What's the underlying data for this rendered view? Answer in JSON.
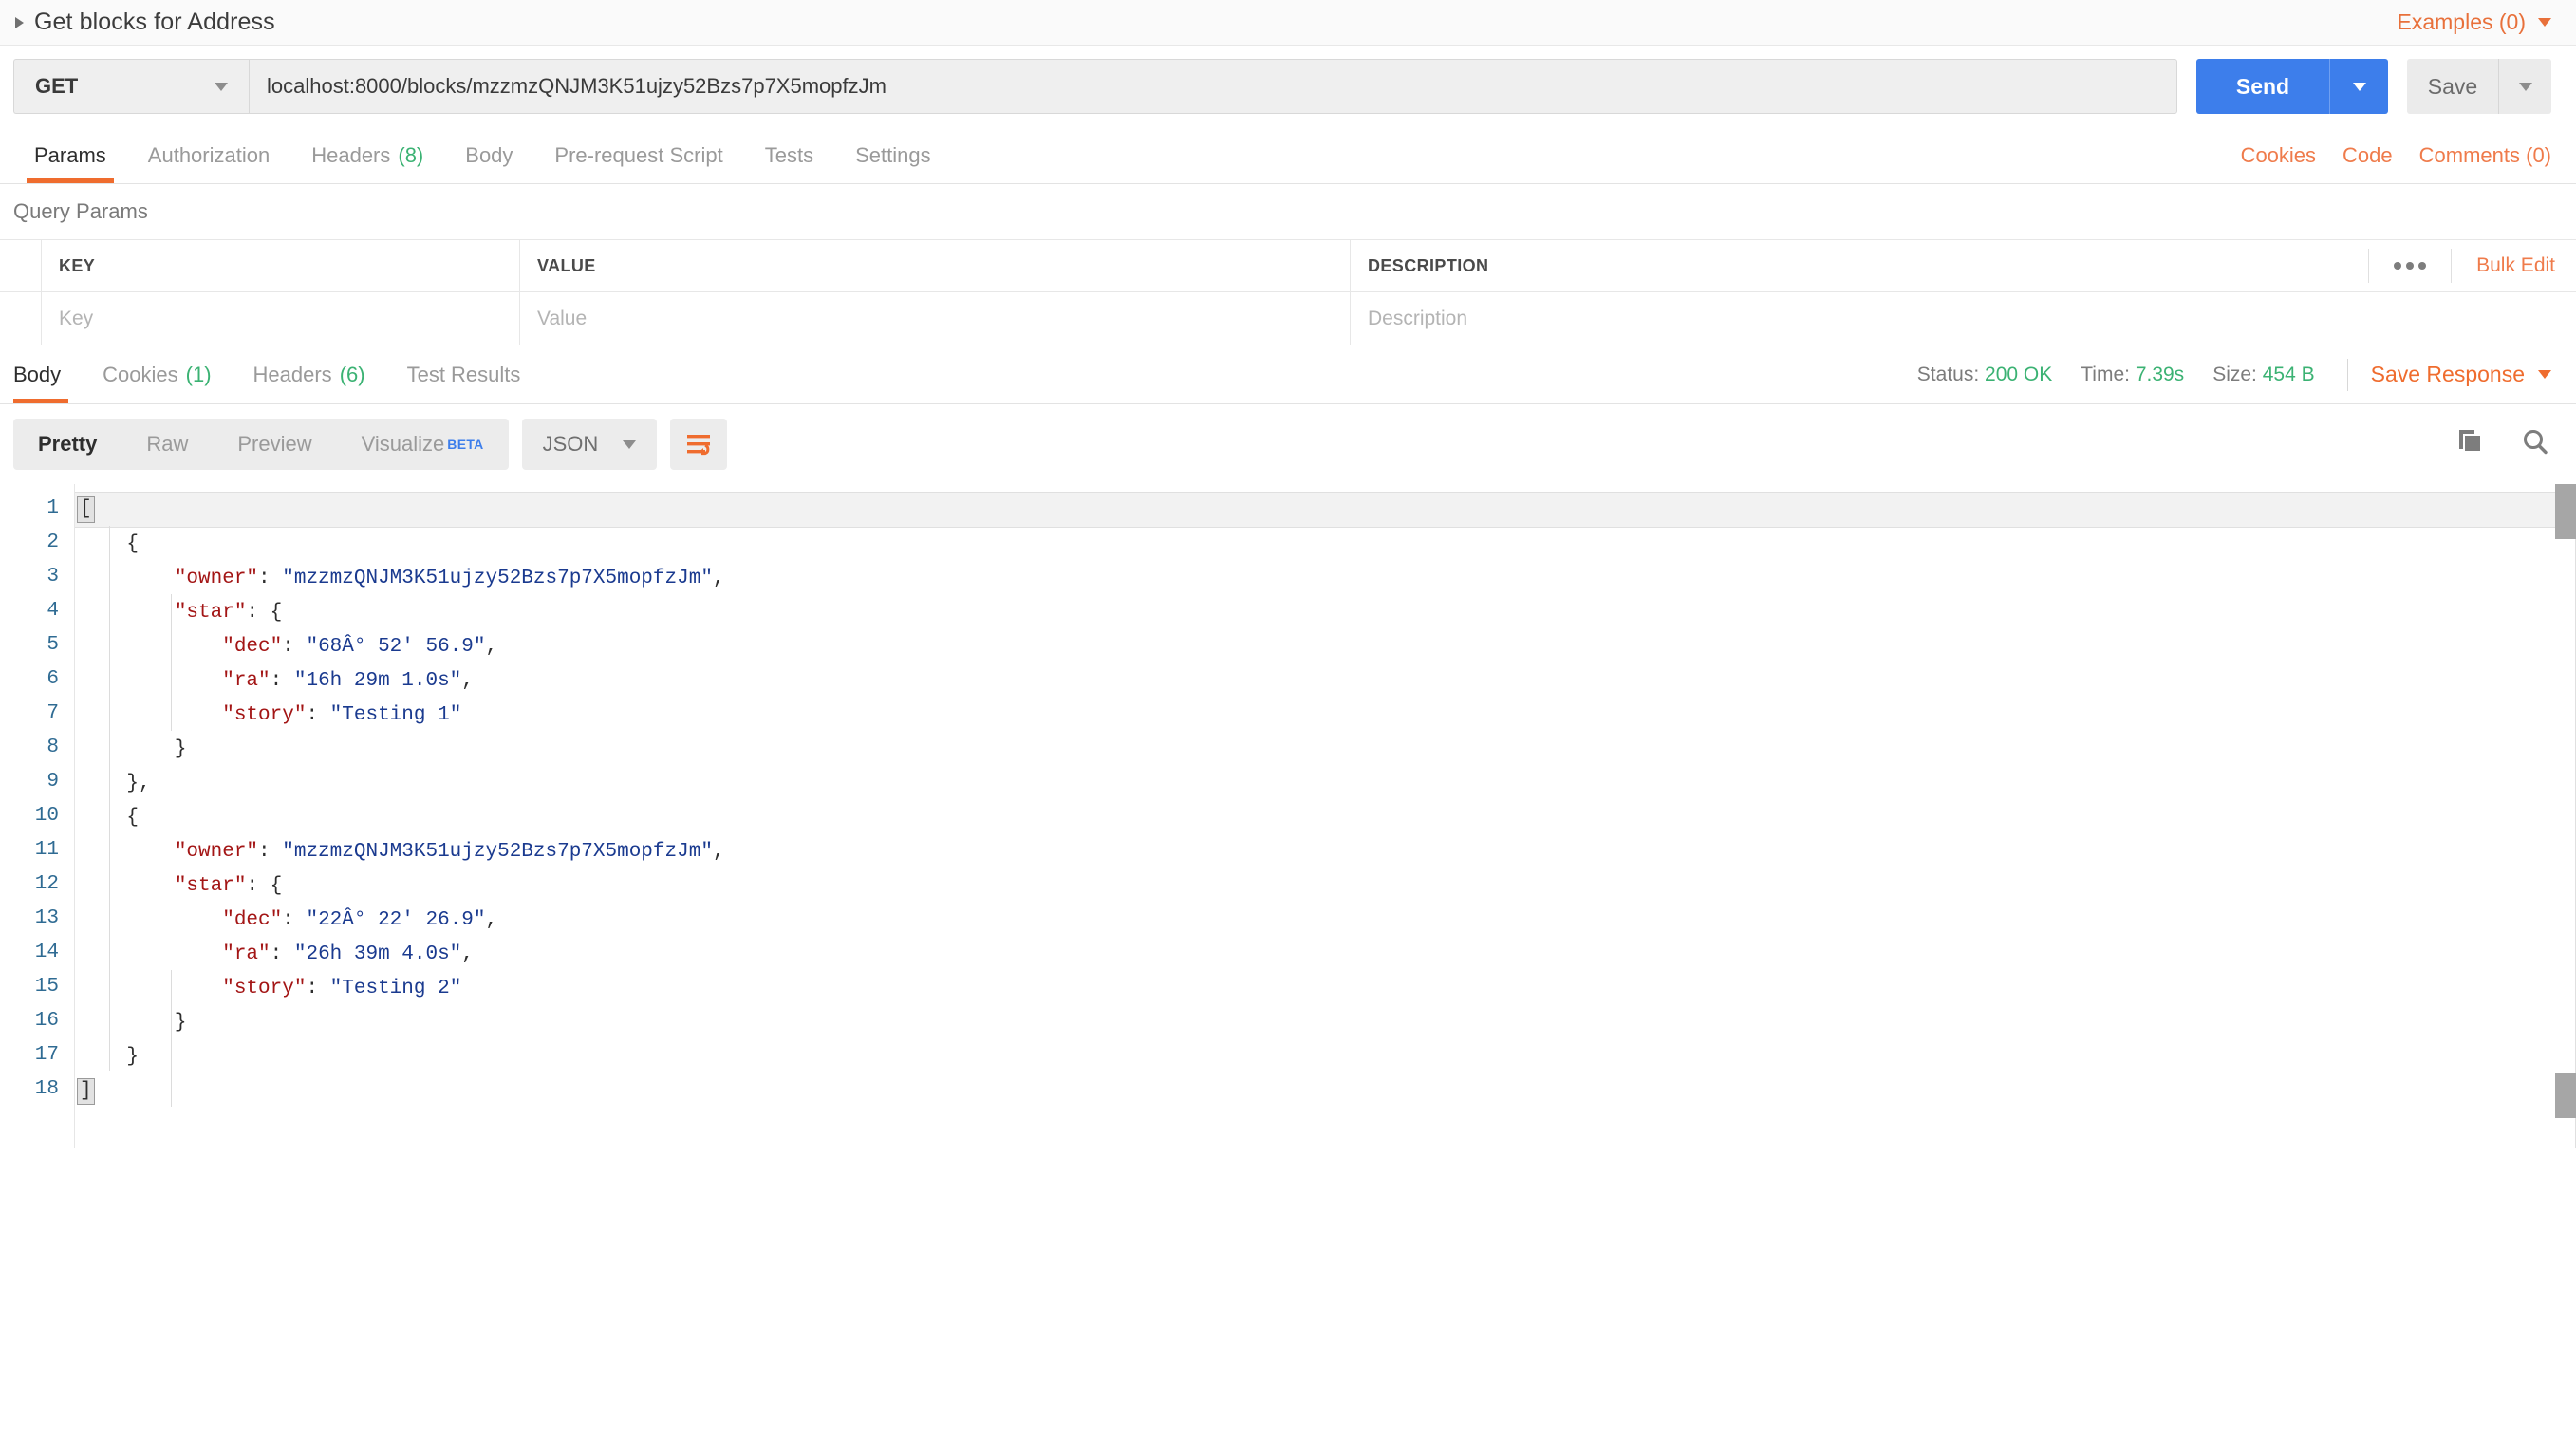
{
  "request_header": {
    "title": "Get blocks for Address",
    "expand_icon": "caret-right-icon",
    "examples_label": "Examples (0)"
  },
  "url_bar": {
    "method": "GET",
    "url": "localhost:8000/blocks/mzzmzQNJM3K51ujzy52Bzs7p7X5mopfzJm",
    "send_label": "Send",
    "save_label": "Save"
  },
  "request_tabs": {
    "items": [
      {
        "label": "Params",
        "count": "",
        "active": true
      },
      {
        "label": "Authorization",
        "count": "",
        "active": false
      },
      {
        "label": "Headers",
        "count": "(8)",
        "active": false
      },
      {
        "label": "Body",
        "count": "",
        "active": false
      },
      {
        "label": "Pre-request Script",
        "count": "",
        "active": false
      },
      {
        "label": "Tests",
        "count": "",
        "active": false
      },
      {
        "label": "Settings",
        "count": "",
        "active": false
      }
    ],
    "right_links": [
      {
        "label": "Cookies"
      },
      {
        "label": "Code"
      },
      {
        "label": "Comments (0)"
      }
    ]
  },
  "query_params": {
    "section_title": "Query Params",
    "columns": [
      "KEY",
      "VALUE",
      "DESCRIPTION"
    ],
    "rows": [
      {
        "key": "",
        "value": "",
        "description": ""
      }
    ],
    "placeholders": {
      "key": "Key",
      "value": "Value",
      "description": "Description"
    },
    "bulk_edit_label": "Bulk Edit",
    "more_icon": "ellipsis-icon"
  },
  "response": {
    "tabs": [
      {
        "label": "Body",
        "count": "",
        "active": true
      },
      {
        "label": "Cookies",
        "count": "(1)",
        "active": false
      },
      {
        "label": "Headers",
        "count": "(6)",
        "active": false
      },
      {
        "label": "Test Results",
        "count": "",
        "active": false
      }
    ],
    "status_label": "Status:",
    "status_value": "200 OK",
    "time_label": "Time:",
    "time_value": "7.39s",
    "size_label": "Size:",
    "size_value": "454 B",
    "save_response_label": "Save Response"
  },
  "body_toolbar": {
    "view_modes": [
      {
        "label": "Pretty",
        "active": true
      },
      {
        "label": "Raw",
        "active": false
      },
      {
        "label": "Preview",
        "active": false
      },
      {
        "label": "Visualize",
        "active": false,
        "badge": "BETA"
      }
    ],
    "format": "JSON",
    "wrap_icon": "word-wrap-icon",
    "copy_icon": "copy-icon",
    "search_icon": "search-icon"
  },
  "code": {
    "line_numbers": [
      "1",
      "2",
      "3",
      "4",
      "5",
      "6",
      "7",
      "8",
      "9",
      "10",
      "11",
      "12",
      "13",
      "14",
      "15",
      "16",
      "17",
      "18"
    ],
    "lines": [
      {
        "n": "1",
        "text": "["
      },
      {
        "n": "2",
        "text": "    {"
      },
      {
        "n": "3",
        "text": "        \"owner\": \"mzzmzQNJM3K51ujzy52Bzs7p7X5mopfzJm\","
      },
      {
        "n": "4",
        "text": "        \"star\": {"
      },
      {
        "n": "5",
        "text": "            \"dec\": \"68Â° 52' 56.9\","
      },
      {
        "n": "6",
        "text": "            \"ra\": \"16h 29m 1.0s\","
      },
      {
        "n": "7",
        "text": "            \"story\": \"Testing 1\""
      },
      {
        "n": "8",
        "text": "        }"
      },
      {
        "n": "9",
        "text": "    },"
      },
      {
        "n": "10",
        "text": "    {"
      },
      {
        "n": "11",
        "text": "        \"owner\": \"mzzmzQNJM3K51ujzy52Bzs7p7X5mopfzJm\","
      },
      {
        "n": "12",
        "text": "        \"star\": {"
      },
      {
        "n": "13",
        "text": "            \"dec\": \"22Â° 22' 26.9\","
      },
      {
        "n": "14",
        "text": "            \"ra\": \"26h 39m 4.0s\","
      },
      {
        "n": "15",
        "text": "            \"story\": \"Testing 2\""
      },
      {
        "n": "16",
        "text": "        }"
      },
      {
        "n": "17",
        "text": "    }"
      },
      {
        "n": "18",
        "text": "]"
      }
    ]
  },
  "colors": {
    "accent_orange": "#ef6c2e",
    "link_orange": "#ef7b4b",
    "send_blue": "#3d7eeb",
    "success_green": "#3bb273",
    "json_key": "#a31515",
    "json_string": "#1a3a8f",
    "line_number": "#2f6b93"
  }
}
